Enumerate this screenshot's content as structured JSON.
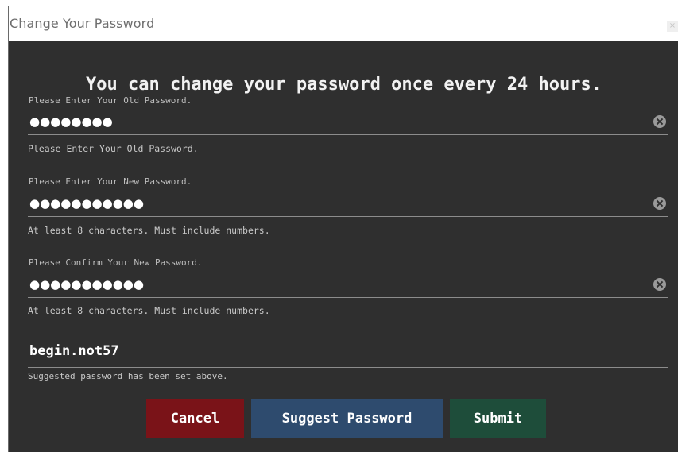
{
  "window": {
    "title": "Change Your Password",
    "close_symbol": "×"
  },
  "headline": "You can change your password once every 24 hours.",
  "fields": [
    {
      "label": "Please Enter Your Old Password.",
      "value_masked": "●●●●●●●●",
      "helper": "Please Enter Your Old Password.",
      "clear_icon": "clear-circle-x"
    },
    {
      "label": "Please Enter Your New Password.",
      "value_masked": "●●●●●●●●●●●",
      "helper": "At least 8 characters. Must include numbers.",
      "clear_icon": "clear-circle-x"
    },
    {
      "label": "Please Confirm Your New Password.",
      "value_masked": "●●●●●●●●●●●",
      "helper": "At least 8 characters. Must include numbers.",
      "clear_icon": "clear-circle-x"
    }
  ],
  "suggestion": {
    "value": "begin.not57",
    "helper": "Suggested password has been set above."
  },
  "buttons": {
    "cancel": "Cancel",
    "suggest": "Suggest Password",
    "submit": "Submit"
  },
  "colors": {
    "background": "#2f2f2f",
    "cancel": "#7a1318",
    "suggest": "#2e4b6e",
    "submit": "#1e4d3a"
  }
}
